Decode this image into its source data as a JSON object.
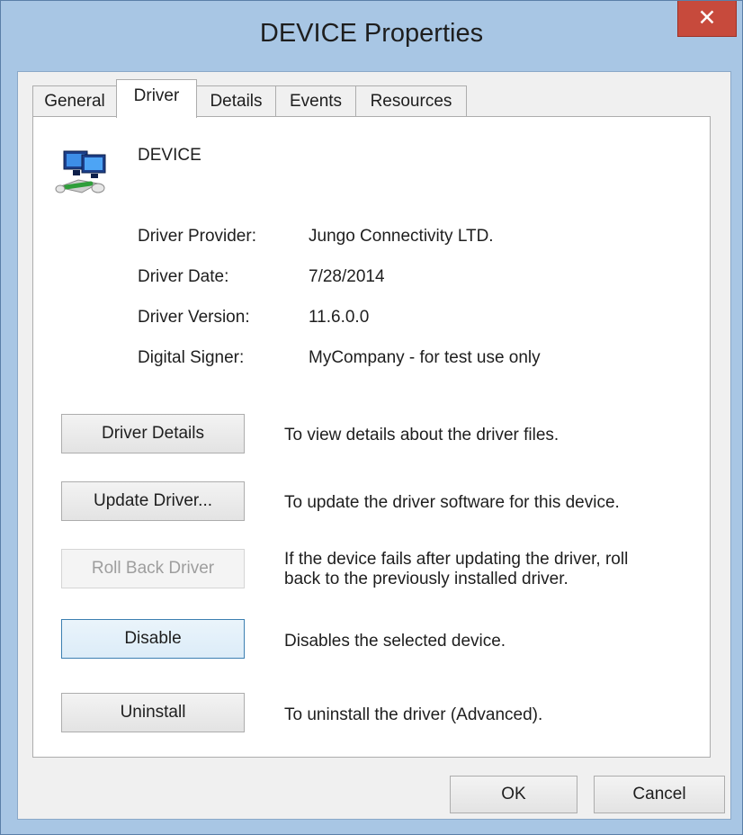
{
  "window": {
    "title": "DEVICE Properties",
    "close_glyph": "✕"
  },
  "tabs": [
    {
      "label": "General",
      "active": false
    },
    {
      "label": "Driver",
      "active": true
    },
    {
      "label": "Details",
      "active": false
    },
    {
      "label": "Events",
      "active": false
    },
    {
      "label": "Resources",
      "active": false
    }
  ],
  "device": {
    "icon": "network-adapter-icon",
    "name": "DEVICE"
  },
  "properties": [
    {
      "label": "Driver Provider:",
      "value": "Jungo Connectivity LTD."
    },
    {
      "label": "Driver Date:",
      "value": "7/28/2014"
    },
    {
      "label": "Driver Version:",
      "value": "11.6.0.0"
    },
    {
      "label": "Digital Signer:",
      "value": "MyCompany - for test use only"
    }
  ],
  "actions": [
    {
      "label": "Driver Details",
      "description": "To view details about the driver files.",
      "enabled": true
    },
    {
      "label": "Update Driver...",
      "description": "To update the driver software for this device.",
      "enabled": true
    },
    {
      "label": "Roll Back Driver",
      "description_line1": "If the device fails after updating the driver, roll",
      "description_line2": "back to the previously installed driver.",
      "enabled": false
    },
    {
      "label": "Disable",
      "description": "Disables the selected device.",
      "enabled": true,
      "focused": true
    },
    {
      "label": "Uninstall",
      "description": "To uninstall the driver (Advanced).",
      "enabled": true
    }
  ],
  "footer": {
    "ok_label": "OK",
    "cancel_label": "Cancel"
  },
  "colors": {
    "frame": "#a8c6e4",
    "close": "#c74a3c",
    "panel": "#ffffff",
    "client": "#f0f0f0"
  }
}
